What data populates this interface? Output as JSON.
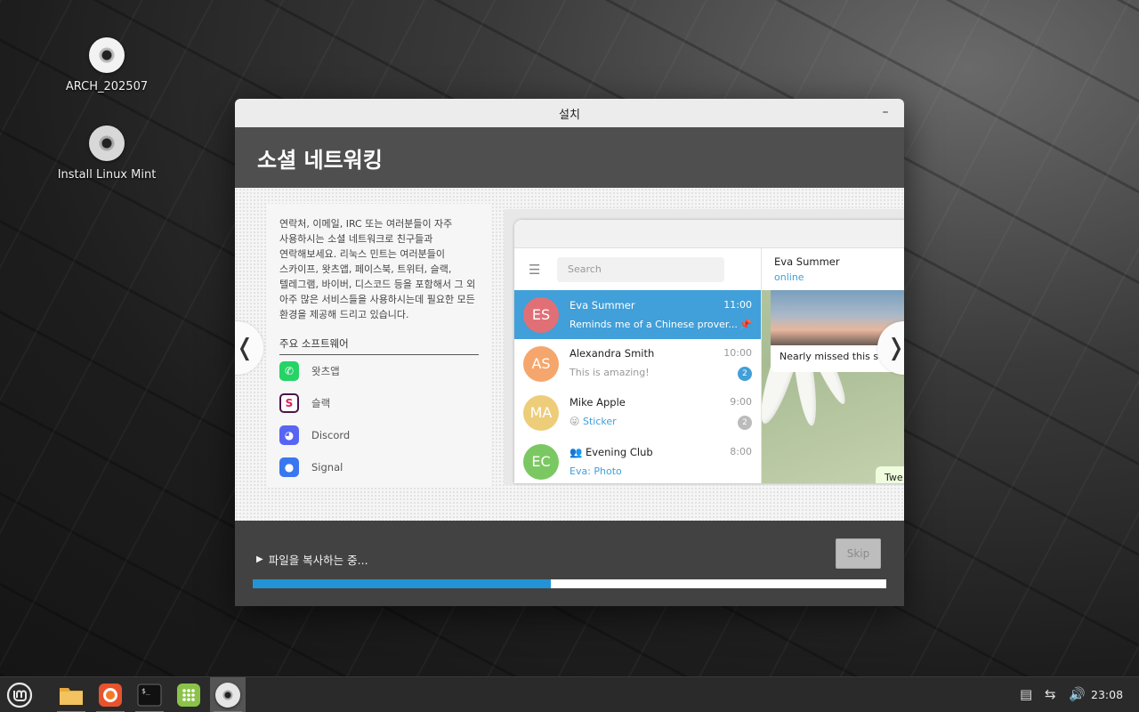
{
  "desktop": {
    "icons": [
      {
        "label": "ARCH_202507"
      },
      {
        "label": "Install Linux Mint"
      }
    ]
  },
  "installer": {
    "window_title": "설치",
    "minimize_label": "–",
    "slide_title": "소셜 네트워킹",
    "description": "연락처, 이메일, IRC 또는 여러분들이 자주 사용하시는 소셜 네트워크로 친구들과 연락해보세요. 리눅스 민트는 여러분들이 스카이프, 왓츠앱, 페이스북, 트위터, 슬랙, 텔레그램, 바이버, 디스코드 등을 포함해서 그 외 아주 많은 서비스들을 사용하시는데 필요한 모든 환경을 제공해 드리고 있습니다.",
    "software_heading": "주요 소프트웨어",
    "apps": [
      {
        "label": "왓츠앱",
        "icon": "whatsapp-icon",
        "color": "#25d366"
      },
      {
        "label": "슬랙",
        "icon": "slack-icon",
        "color": "#4a154b"
      },
      {
        "label": "Discord",
        "icon": "discord-icon",
        "color": "#5865f2"
      },
      {
        "label": "Signal",
        "icon": "signal-icon",
        "color": "#3a76f0"
      }
    ],
    "prev_label": "❬",
    "next_label": "❭",
    "status_text": "파일을 복사하는 중...",
    "skip_label": "Skip",
    "progress": 0.47
  },
  "mockup": {
    "search_placeholder": "Search",
    "chats": [
      {
        "initials": "ES",
        "name": "Eva Summer",
        "time": "11:00",
        "preview": "Reminds me of a Chinese prover...",
        "avatar_color": "#e17076",
        "pinned": true,
        "badge": ""
      },
      {
        "initials": "AS",
        "name": "Alexandra Smith",
        "time": "10:00",
        "preview": "This is amazing!",
        "avatar_color": "#f5a66d",
        "badge": "2"
      },
      {
        "initials": "MA",
        "name": "Mike Apple",
        "time": "9:00",
        "preview": "Sticker",
        "avatar_color": "#eecd7a",
        "badge": "2"
      },
      {
        "initials": "EC",
        "name": "Evening Club",
        "time": "8:00",
        "preview": "Eva: Photo",
        "avatar_color": "#7bc862",
        "badge": ""
      }
    ],
    "chat_name": "Eva Summer",
    "chat_status": "online",
    "photo_caption": "Nearly missed this s",
    "bubble_text": "Twe"
  },
  "taskbar": {
    "clock": "23:08"
  },
  "colors": {
    "accent": "#2493d6",
    "telegram_blue": "#419fd9"
  }
}
